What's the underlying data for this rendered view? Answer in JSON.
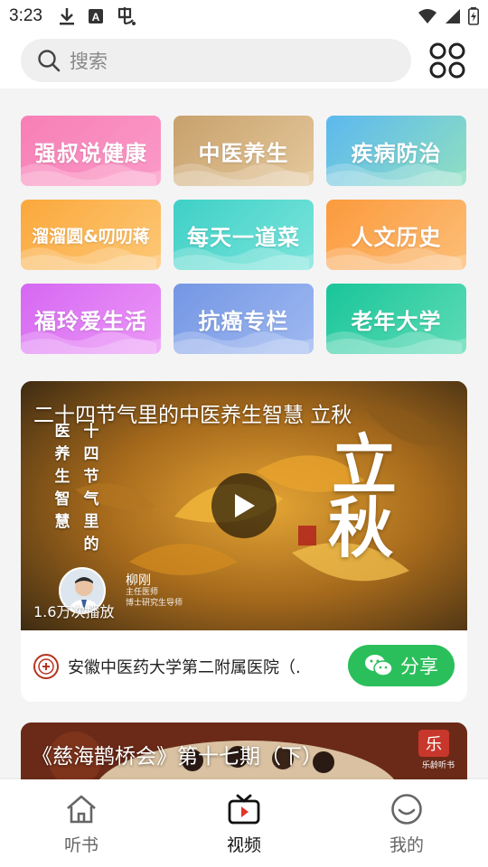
{
  "status_bar": {
    "time": "3:23",
    "left_icons": [
      "download-icon",
      "a-icon",
      "bug-icon"
    ],
    "right_icons": [
      "wifi-icon",
      "signal-icon",
      "battery-charging-icon"
    ]
  },
  "search": {
    "placeholder": "搜索",
    "icon": "search-icon",
    "grid_icon": "grid-menu-icon"
  },
  "categories": [
    {
      "label": "强叔说健康",
      "colors": [
        "#f77fb6",
        "#fb9ac8"
      ]
    },
    {
      "label": "中医养生",
      "colors": [
        "#c7a16c",
        "#e5c89c"
      ]
    },
    {
      "label": "疾病防治",
      "colors": [
        "#5cb8ef",
        "#8fe0c0"
      ]
    },
    {
      "label": "溜溜圆&叨叨蒋",
      "colors": [
        "#fba83b",
        "#fdc877"
      ]
    },
    {
      "label": "每天一道菜",
      "colors": [
        "#3ed0c6",
        "#7be5dc"
      ]
    },
    {
      "label": "人文历史",
      "colors": [
        "#fb9a3c",
        "#fdbe78"
      ]
    },
    {
      "label": "福玲爱生活",
      "colors": [
        "#d667f2",
        "#ec98f7"
      ]
    },
    {
      "label": "抗癌专栏",
      "colors": [
        "#7496e4",
        "#9fb9f1"
      ]
    },
    {
      "label": "老年大学",
      "colors": [
        "#19c59a",
        "#5fdcb6"
      ]
    }
  ],
  "video": {
    "title": "二十四节气里的中医养生智慧 立秋",
    "vertical_col_1": "十四节气里的",
    "vertical_col_2": "医养生智慧",
    "calligraphy_1": "立",
    "calligraphy_2": "秋",
    "doctor_name": "柳刚",
    "doctor_title_1": "主任医师",
    "doctor_title_2": "博士研究生导师",
    "play_count": "1.6万次播放",
    "source": "安徽中医药大学第二附属医院（...",
    "share_label": "分享",
    "accent": "#2bbf5b"
  },
  "video2": {
    "title": "《慈海鹊桥会》第十七期（下）",
    "brand_char": "乐",
    "brand_text": "乐龄听书"
  },
  "nav": [
    {
      "label": "听书",
      "icon": "house-icon",
      "active": false
    },
    {
      "label": "视频",
      "icon": "tv-play-icon",
      "active": true
    },
    {
      "label": "我的",
      "icon": "smile-face-icon",
      "active": false
    }
  ]
}
